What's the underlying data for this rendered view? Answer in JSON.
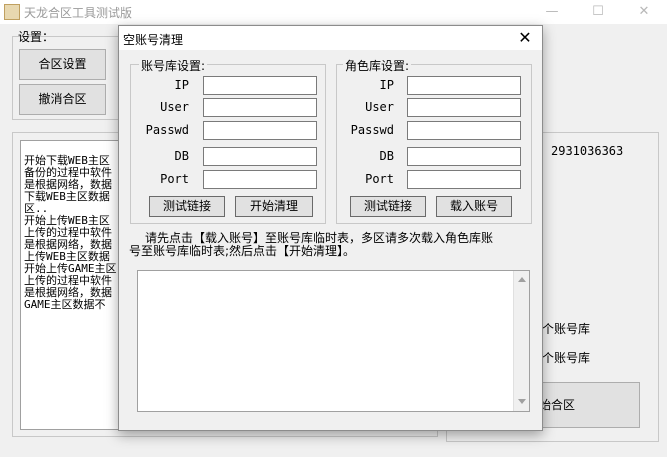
{
  "main": {
    "title": "天龙合区工具测试版",
    "window_controls": {
      "minimize": "—",
      "maximize": "☐",
      "close": "✕"
    },
    "settings_label": "设置：",
    "buttons": {
      "merge_settings": "合区设置",
      "cancel_merge": "撤消合区"
    },
    "log_lines": [
      "开始下载WEB主区",
      "备份的过程中软件",
      "是根据网络，数据",
      "下载WEB主区数据",
      "区..",
      "开始上传WEB主区",
      "上传的过程中软件",
      "是根据网络，数据",
      "上传WEB主区数据",
      "开始上传GAME主区",
      "上传的过程中软件",
      "是根据网络，数据",
      "GAME主区数据不"
    ],
    "qq": "2931036363",
    "radio_texts": [
      "一个账号库",
      "两个账号库"
    ],
    "start_merge_partial": "始合区"
  },
  "dialog": {
    "title": "空账号清理",
    "close": "✕",
    "account_db": {
      "legend": "账号库设置:",
      "fields": [
        {
          "label": "IP",
          "value": ""
        },
        {
          "label": "User",
          "value": ""
        },
        {
          "label": "Passwd",
          "value": ""
        },
        {
          "label": "DB",
          "value": ""
        },
        {
          "label": "Port",
          "value": ""
        }
      ],
      "test_button": "测试链接",
      "start_button": "开始清理"
    },
    "role_db": {
      "legend": "角色库设置:",
      "fields": [
        {
          "label": "IP",
          "value": ""
        },
        {
          "label": "User",
          "value": ""
        },
        {
          "label": "Passwd",
          "value": ""
        },
        {
          "label": "DB",
          "value": ""
        },
        {
          "label": "Port",
          "value": ""
        }
      ],
      "test_button": "测试链接",
      "load_button": "载入账号"
    },
    "info_lines": [
      "请先点击【载入账号】至账号库临时表，多区请多次载入角色库账",
      "号至账号库临时表;然后点击【开始清理】。"
    ],
    "result_text": ""
  }
}
